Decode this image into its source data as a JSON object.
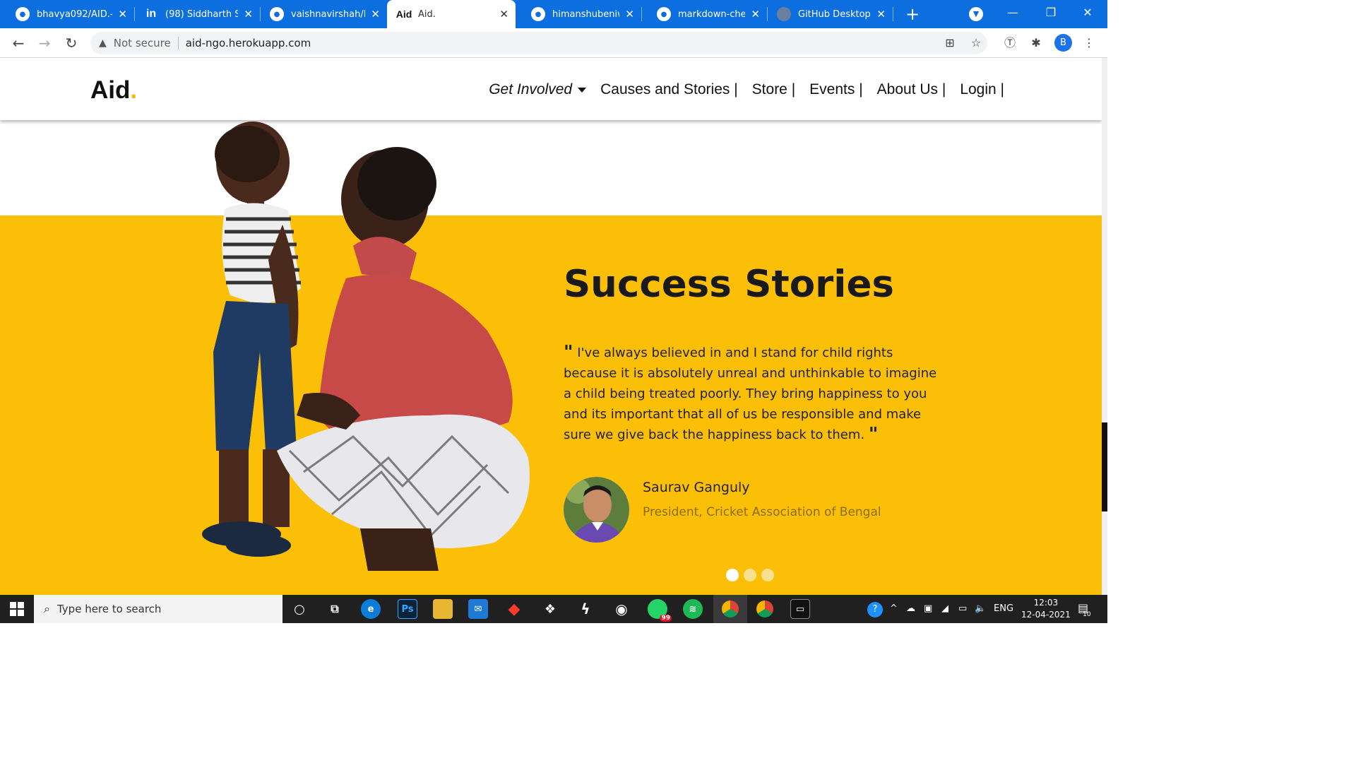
{
  "browser": {
    "tabs": [
      {
        "title": "bhavya092/AID.-N",
        "icon": "github-icon"
      },
      {
        "title": "(98) Siddharth Sha",
        "icon": "linkedin-icon"
      },
      {
        "title": "vaishnavirshah/Fa",
        "icon": "github-icon"
      },
      {
        "title": "Aid.",
        "icon": "aid-favicon",
        "favicon_text": "Aid",
        "active": true
      },
      {
        "title": "himanshubeniwal/",
        "icon": "github-icon"
      },
      {
        "title": "markdown-cheats",
        "icon": "github-icon"
      },
      {
        "title": "GitHub Desktop |",
        "icon": "github-desktop-icon"
      }
    ],
    "security_label": "Not secure",
    "url": "aid-ngo.herokuapp.com",
    "profile_initial": "B"
  },
  "site": {
    "logo": "Aid",
    "logo_dot": ".",
    "nav": [
      {
        "label": "Get Involved",
        "dropdown": true
      },
      {
        "label": "Causes and Stories |"
      },
      {
        "label": "Store |"
      },
      {
        "label": "Events |"
      },
      {
        "label": "About Us |"
      },
      {
        "label": "Login |"
      }
    ],
    "accent": "#fcbf07"
  },
  "story": {
    "heading": "Success Stories",
    "open_quote": "\"",
    "quote": "I've always believed in and I stand for child rights because it is absolutely unreal and unthinkable to imagine a child being treated poorly. They bring happiness to you and its important that all of us be responsible and make sure we give back the happiness back to them.",
    "close_quote": "\"",
    "author_name": "Saurav Ganguly",
    "author_role": "President, Cricket Association of Bengal",
    "carousel_active": 1,
    "carousel_count": 3
  },
  "taskbar": {
    "search_placeholder": "Type here to search",
    "language": "ENG",
    "time": "12:03",
    "date": "12-04-2021",
    "whatsapp_badge": "99",
    "notification_count": "10"
  }
}
